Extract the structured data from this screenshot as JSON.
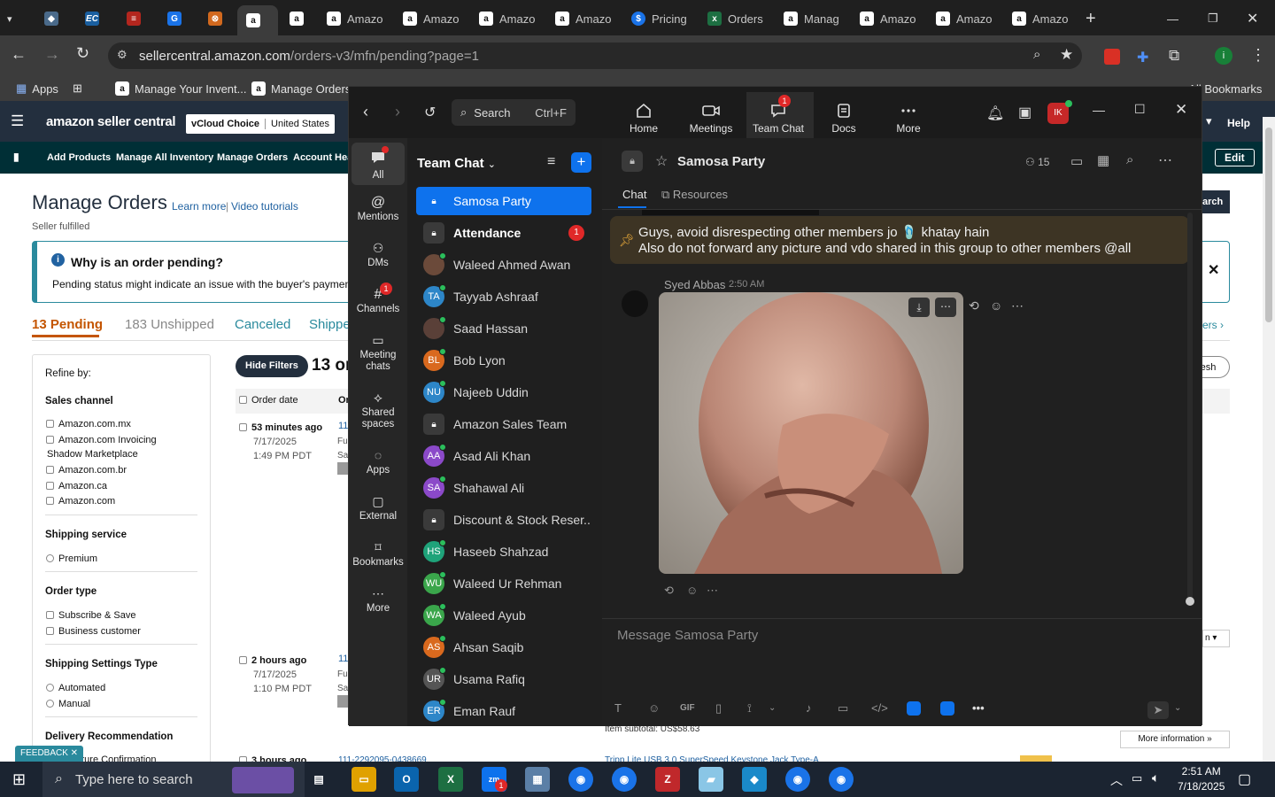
{
  "browser": {
    "tabs": [
      {
        "label": "",
        "icon": "tab-list-icon"
      },
      {
        "label": "",
        "icon": "app-icon"
      },
      {
        "label": "",
        "icon": "ec-icon"
      },
      {
        "label": "",
        "icon": "pdf-icon"
      },
      {
        "label": "",
        "icon": "docs-icon"
      },
      {
        "label": "",
        "icon": "box-icon"
      },
      {
        "label": "",
        "icon": "amazon-icon"
      },
      {
        "label": "",
        "icon": "amazon-icon"
      },
      {
        "label": "Amazo",
        "icon": "amazon-icon"
      },
      {
        "label": "Amazo",
        "icon": "amazon-icon"
      },
      {
        "label": "Amazo",
        "icon": "amazon-icon"
      },
      {
        "label": "Amazo",
        "icon": "amazon-icon"
      },
      {
        "label": "Pricing",
        "icon": "dollar-icon"
      },
      {
        "label": "Orders",
        "icon": "excel-icon"
      },
      {
        "label": "Manag",
        "icon": "amazon-icon"
      },
      {
        "label": "Amazo",
        "icon": "amazon-icon"
      },
      {
        "label": "Amazo",
        "icon": "amazon-icon"
      },
      {
        "label": "Amazo",
        "icon": "amazon-icon"
      }
    ],
    "url_host": "sellercentral.amazon.com",
    "url_path": "/orders-v3/mfn/pending?page=1",
    "bookmarks": {
      "apps": "Apps",
      "items": [
        "Manage Your Invent...",
        "Manage Orders"
      ],
      "all_bookmarks": "All Bookmarks"
    }
  },
  "amazon": {
    "logo": "amazon seller central",
    "store_label": "vCloud Choice",
    "store_region": "United States",
    "help": "Help",
    "nav": [
      "Add Products",
      "Manage All Inventory",
      "Manage Orders",
      "Account Heal"
    ],
    "edit": "Edit",
    "page_title": "Manage Orders",
    "learn_more": "Learn more",
    "video_tutorials": "Video tutorials",
    "seller_fulfilled": "Seller fulfilled",
    "search_btn": "arch",
    "alert_title": "Why is an order pending?",
    "alert_body": "Pending status might indicate an issue with the buyer's payment m",
    "tabs": [
      {
        "label": "13 Pending",
        "active": true
      },
      {
        "label": "183 Unshipped"
      },
      {
        "label": "Canceled"
      },
      {
        "label": "Shipped"
      }
    ],
    "tab_right": "ers",
    "refresh": "resh",
    "hide_filters": "Hide Filters",
    "orders_count_title": "13 or",
    "refine": {
      "title": "Refine by:",
      "sales_channel": "Sales channel",
      "channels": [
        "Amazon.com.mx",
        "Amazon.com Invoicing",
        "Shadow Marketplace",
        "Amazon.com.br",
        "Amazon.ca",
        "Amazon.com"
      ],
      "shipping_service": "Shipping service",
      "premium": "Premium",
      "order_type": "Order type",
      "order_types": [
        "Subscribe & Save",
        "Business customer"
      ],
      "shipping_settings": "Shipping Settings Type",
      "settings": [
        "Automated",
        "Manual"
      ],
      "delivery_rec": "Delivery Recommendation",
      "sig_conf": "ature Confirmation"
    },
    "col_order_date": "Order date",
    "col_order": "Or",
    "orders": [
      {
        "ago": "53 minutes ago",
        "date": "7/17/2025",
        "time": "1:49 PM PDT",
        "id": "11"
      },
      {
        "ago": "2 hours ago",
        "date": "7/17/2025",
        "time": "1:10 PM PDT",
        "id": "11"
      },
      {
        "ago": "3 hours ago",
        "id": "111-2292095-0438669"
      }
    ],
    "item_subtotal": "Item subtotal: US$58.63",
    "more_info": "More information",
    "product_title": "Tripp Lite USB 3.0 SuperSpeed Keystone Jack Type-A",
    "n_select": "n",
    "feedback": "FEEDBACK"
  },
  "zoom": {
    "search": "Search",
    "search_shortcut": "Ctrl+F",
    "top_tabs": [
      {
        "label": "Home",
        "icon": "home-icon"
      },
      {
        "label": "Meetings",
        "icon": "video-icon"
      },
      {
        "label": "Team Chat",
        "icon": "chat-icon",
        "badge": "1"
      },
      {
        "label": "Docs",
        "icon": "doc-icon"
      },
      {
        "label": "More",
        "icon": "more-icon"
      }
    ],
    "avatar_initials": "IK",
    "rail": [
      {
        "label": "All",
        "icon": "chat-bubble-icon"
      },
      {
        "label": "Mentions",
        "icon": "at-icon"
      },
      {
        "label": "DMs",
        "icon": "people-icon"
      },
      {
        "label": "Channels",
        "icon": "hash-icon",
        "badge": "1"
      },
      {
        "label": "Meeting chats",
        "icon": "calendar-icon"
      },
      {
        "label": "Shared spaces",
        "icon": "share-icon"
      },
      {
        "label": "Apps",
        "icon": "apps-icon"
      },
      {
        "label": "External",
        "icon": "external-icon"
      },
      {
        "label": "Bookmarks",
        "icon": "bookmark-icon"
      },
      {
        "label": "More",
        "icon": "more-icon"
      }
    ],
    "list_title": "Team Chat",
    "channels": [
      {
        "name": "Samosa Party",
        "type": "lock",
        "selected": true
      },
      {
        "name": "Attendance",
        "type": "lock",
        "bold": true,
        "badge": "1"
      },
      {
        "name": "Waleed Ahmed Awan",
        "type": "photo",
        "color": "#6b4a3a"
      },
      {
        "name": "Tayyab Ashraaf",
        "initials": "TA",
        "color": "#2d86c8"
      },
      {
        "name": "Saad Hassan",
        "type": "photo",
        "color": "#5a4038"
      },
      {
        "name": "Bob Lyon",
        "initials": "BL",
        "color": "#d9691e"
      },
      {
        "name": "Najeeb Uddin",
        "initials": "NU",
        "color": "#2d86c8"
      },
      {
        "name": "Amazon Sales Team",
        "type": "lock"
      },
      {
        "name": "Asad Ali Khan",
        "initials": "AA",
        "color": "#8b49c9"
      },
      {
        "name": "Shahawal Ali",
        "initials": "SA",
        "color": "#8b49c9"
      },
      {
        "name": "Discount & Stock Reser...",
        "type": "lock"
      },
      {
        "name": "Haseeb Shahzad",
        "initials": "HS",
        "color": "#1fa37a"
      },
      {
        "name": "Waleed Ur Rehman",
        "initials": "WU",
        "color": "#3aa64b"
      },
      {
        "name": "Waleed Ayub",
        "initials": "WA",
        "color": "#3aa64b"
      },
      {
        "name": "Ahsan Saqib",
        "initials": "AS",
        "color": "#d9691e"
      },
      {
        "name": "Usama Rafiq",
        "initials": "UR",
        "color": "#555"
      },
      {
        "name": "Eman Rauf",
        "initials": "ER",
        "color": "#2d86c8"
      }
    ],
    "chat": {
      "title": "Samosa Party",
      "members": "15",
      "tabs": [
        "Chat",
        "Resources"
      ],
      "pinned_line1": "Guys, avoid disrespecting other members jo 🩴 khatay hain",
      "pinned_line2": "Also do not forward any picture and vdo shared in this group to other members @all",
      "sender": "Syed Abbas",
      "time": "2:50 AM",
      "composer_placeholder": "Message Samosa Party"
    }
  },
  "taskbar": {
    "search_placeholder": "Type here to search",
    "time": "2:51 AM",
    "date": "7/18/2025",
    "zoom_badge": "1"
  }
}
